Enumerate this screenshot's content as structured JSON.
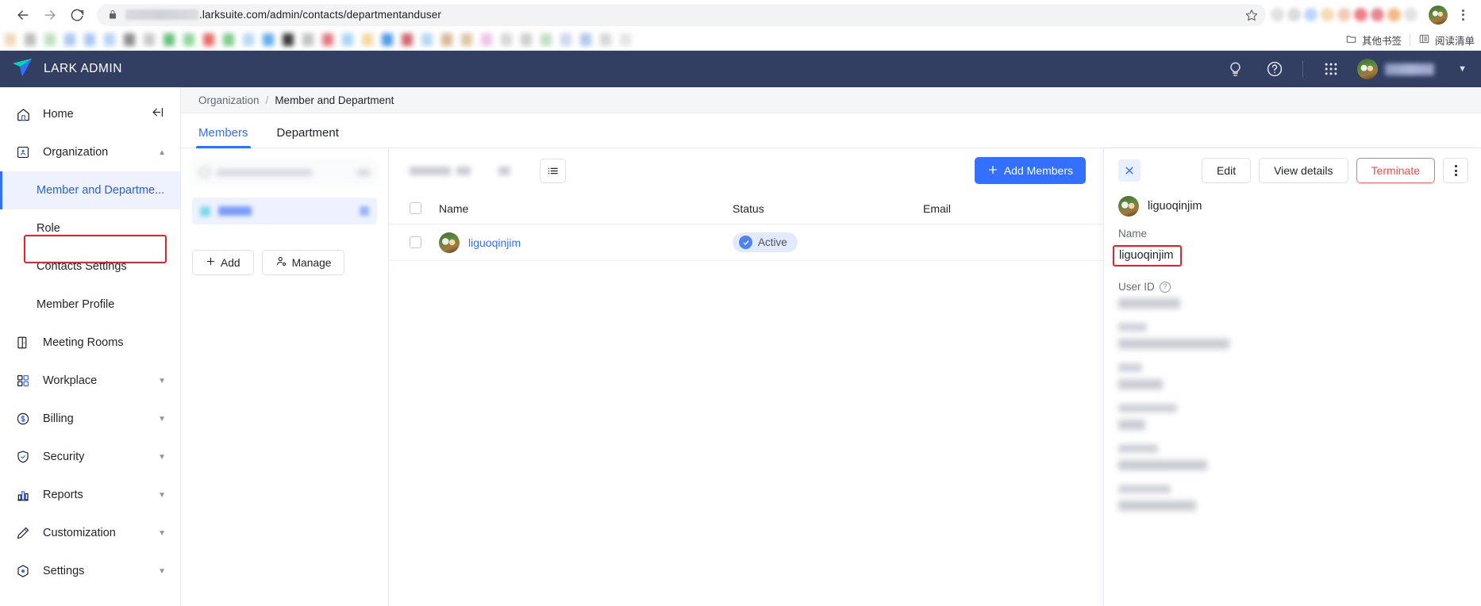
{
  "browser": {
    "url_prefix_redacted": true,
    "url": ".larksuite.com/admin/contacts/departmentanduser",
    "back_icon": "back-arrow-icon",
    "forward_icon": "forward-arrow-icon",
    "reload_icon": "reload-icon",
    "lock_icon": "lock-icon",
    "star_icon": "bookmark-star-icon",
    "menu_icon": "chrome-menu-icon",
    "bookmarks": {
      "other_bookmarks": "其他书签",
      "reading_list": "阅读清单"
    }
  },
  "header": {
    "brand": "LARK ADMIN",
    "logo_icon": "lark-paper-plane-logo",
    "icons": [
      "lightbulb-icon",
      "help-circle-icon",
      "apps-grid-icon"
    ],
    "user_name_redacted": true,
    "caret": "▼"
  },
  "sidebar": {
    "collapse_icon": "collapse-sidebar-icon",
    "items": [
      {
        "label": "Home",
        "icon": "home-icon",
        "type": "top",
        "arrow": ""
      },
      {
        "label": "Organization",
        "icon": "organization-icon",
        "type": "top",
        "arrow": "▲"
      },
      {
        "label": "Member and Departme...",
        "icon": "",
        "type": "sub",
        "active": true
      },
      {
        "label": "Role",
        "icon": "",
        "type": "sub",
        "active": false
      },
      {
        "label": "Contacts Settings",
        "icon": "",
        "type": "sub",
        "active": false
      },
      {
        "label": "Member Profile",
        "icon": "",
        "type": "sub",
        "active": false
      },
      {
        "label": "Meeting Rooms",
        "icon": "meeting-room-icon",
        "type": "top",
        "arrow": ""
      },
      {
        "label": "Workplace",
        "icon": "workplace-grid-icon",
        "type": "top",
        "arrow": "▼"
      },
      {
        "label": "Billing",
        "icon": "billing-dollar-icon",
        "type": "top",
        "arrow": "▼"
      },
      {
        "label": "Security",
        "icon": "security-shield-icon",
        "type": "top",
        "arrow": "▼"
      },
      {
        "label": "Reports",
        "icon": "reports-bar-chart-icon",
        "type": "top",
        "arrow": "▼"
      },
      {
        "label": "Customization",
        "icon": "customization-pencil-icon",
        "type": "top",
        "arrow": "▼"
      },
      {
        "label": "Settings",
        "icon": "settings-gear-icon",
        "type": "top",
        "arrow": "▼"
      }
    ]
  },
  "breadcrumb": {
    "parent": "Organization",
    "separator": "/",
    "current": "Member and Department"
  },
  "tabs": [
    {
      "label": "Members",
      "active": true
    },
    {
      "label": "Department",
      "active": false
    }
  ],
  "dept_panel": {
    "search_placeholder_redacted": true,
    "add_button": "Add",
    "add_icon": "plus-icon",
    "manage_button": "Manage",
    "manage_icon": "manage-user-icon"
  },
  "toolbar": {
    "filter_redacted": true,
    "list_view_icon": "list-view-icon",
    "add_members_label": "Add Members",
    "add_members_icon": "plus-icon"
  },
  "table": {
    "columns": [
      "Name",
      "Status",
      "Email"
    ],
    "rows": [
      {
        "name": "liguoqinjim",
        "status": "Active",
        "status_icon": "check-circle-icon",
        "email_redacted": true,
        "avatar": "user-avatar"
      }
    ]
  },
  "drawer": {
    "close_icon": "close-icon",
    "buttons": [
      {
        "label": "Edit",
        "style": "default"
      },
      {
        "label": "View details",
        "style": "default"
      },
      {
        "label": "Terminate",
        "style": "danger"
      }
    ],
    "more_icon": "more-vertical-icon",
    "user_name": "liguoqinjim",
    "fields": [
      {
        "label": "Name",
        "value": "liguoqinjim",
        "highlighted": true,
        "redacted": false
      },
      {
        "label": "User ID",
        "value": "",
        "help_icon": "help-circle-icon",
        "redacted": true,
        "value_width": 78
      },
      {
        "label": "",
        "value": "",
        "redacted": true,
        "label_width": 36,
        "value_width": 140
      },
      {
        "label": "",
        "value": "",
        "redacted": true,
        "label_width": 30,
        "value_width": 56
      },
      {
        "label": "",
        "value": "",
        "redacted": true,
        "label_width": 74,
        "value_width": 34
      },
      {
        "label": "",
        "value": "",
        "redacted": true,
        "label_width": 50,
        "value_width": 112
      },
      {
        "label": "",
        "value": "",
        "redacted": true,
        "label_width": 66,
        "value_width": 98
      }
    ]
  },
  "colors": {
    "brand_header": "#333e63",
    "accent_blue": "#3370ff",
    "danger_red": "#f54a45",
    "highlight_box": "#e8202a",
    "active_badge_bg": "#e1eaff"
  }
}
